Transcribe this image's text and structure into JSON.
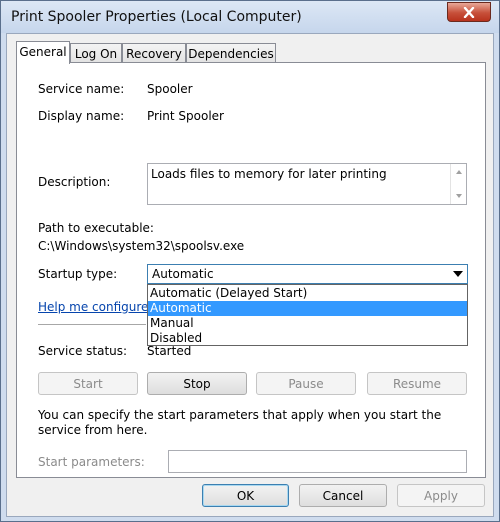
{
  "window": {
    "title": "Print Spooler Properties (Local Computer)"
  },
  "tabs": [
    {
      "label": "General",
      "active": true
    },
    {
      "label": "Log On",
      "active": false
    },
    {
      "label": "Recovery",
      "active": false
    },
    {
      "label": "Dependencies",
      "active": false
    }
  ],
  "general": {
    "service_name_label": "Service name:",
    "service_name_value": "Spooler",
    "display_name_label": "Display name:",
    "display_name_value": "Print Spooler",
    "description_label": "Description:",
    "description_value": "Loads files to memory for later printing",
    "path_label": "Path to executable:",
    "path_value": "C:\\Windows\\system32\\spoolsv.exe",
    "startup_type_label": "Startup type:",
    "startup_type_value": "Automatic",
    "startup_options": [
      "Automatic (Delayed Start)",
      "Automatic",
      "Manual",
      "Disabled"
    ],
    "help_link": "Help me configure s",
    "service_status_label": "Service status:",
    "service_status_value": "Started",
    "buttons": {
      "start": "Start",
      "stop": "Stop",
      "pause": "Pause",
      "resume": "Resume"
    },
    "start_params_info": "You can specify the start parameters that apply when you start the service from here.",
    "start_params_label": "Start parameters:"
  },
  "dialog_buttons": {
    "ok": "OK",
    "cancel": "Cancel",
    "apply": "Apply"
  },
  "colors": {
    "selection": "#3399ff",
    "link": "#0645ad",
    "close": "#c7503a"
  }
}
